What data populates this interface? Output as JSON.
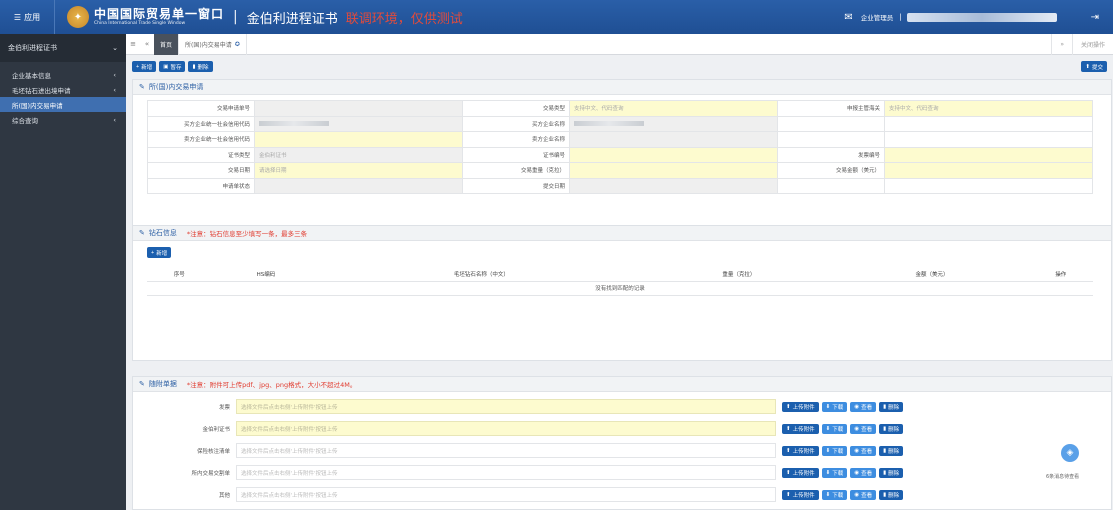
{
  "topbar": {
    "menu_label": "应用",
    "brand_cn": "中国国际贸易单一窗口",
    "brand_en": "China International Trade Single Window",
    "app_title": "金伯利进程证书",
    "env_note": "联调环境，仅供测试",
    "user_label": "企业管理员"
  },
  "sidebar": {
    "header": "金伯利进程证书",
    "items": [
      {
        "label": "企业基本信息",
        "arrow": "‹"
      },
      {
        "label": "毛坯钻石进出境申请",
        "arrow": "‹"
      },
      {
        "label": "所(国)内交易申请",
        "arrow": ""
      },
      {
        "label": "综合查询",
        "arrow": "‹"
      }
    ]
  },
  "tabs": {
    "home": "首页",
    "current": "所(国)内交易申请",
    "close_ops": "关闭操作"
  },
  "toolbar": {
    "add": "新增",
    "save": "暂存",
    "delete": "删除",
    "submit": "提交"
  },
  "trade_panel": {
    "title": "所(国)内交易申请",
    "rows": [
      [
        {
          "label": "交易申请单号",
          "value": "",
          "cls": "val"
        },
        {
          "label": "交易类型",
          "value": "支持中文、代码查询",
          "cls": "val y"
        },
        {
          "label": "申报主管海关",
          "value": "支持中文、代码查询",
          "cls": "val y"
        }
      ],
      [
        {
          "label": "买方企业统一社会信用代码",
          "value": "",
          "cls": "val",
          "blur": true
        },
        {
          "label": "买方企业名称",
          "value": "",
          "cls": "val",
          "blur": true
        },
        {
          "label": "",
          "value": "",
          "cls": "val w"
        }
      ],
      [
        {
          "label": "卖方企业统一社会信用代码",
          "value": "",
          "cls": "val y"
        },
        {
          "label": "卖方企业名称",
          "value": "",
          "cls": "val"
        },
        {
          "label": "",
          "value": "",
          "cls": "val w"
        }
      ],
      [
        {
          "label": "证书类型",
          "value": "金伯利证书",
          "cls": "val"
        },
        {
          "label": "证书编号",
          "value": "",
          "cls": "val y"
        },
        {
          "label": "发票编号",
          "value": "",
          "cls": "val y"
        }
      ],
      [
        {
          "label": "交易日期",
          "value": "请选择日期",
          "cls": "val y"
        },
        {
          "label": "交易重量（克拉）",
          "value": "",
          "cls": "val y"
        },
        {
          "label": "交易金额（美元）",
          "value": "",
          "cls": "val y"
        }
      ],
      [
        {
          "label": "申请单状态",
          "value": "",
          "cls": "val"
        },
        {
          "label": "提交日期",
          "value": "",
          "cls": "val"
        },
        {
          "label": "",
          "value": "",
          "cls": "val w"
        }
      ]
    ]
  },
  "diamond_panel": {
    "title": "钻石信息",
    "note": "*注意：钻石信息至少填写一条，最多三条",
    "add": "新增",
    "columns": [
      "序号",
      "HS编码",
      "毛坯钻石名称（中文）",
      "重量（克拉）",
      "金额（美元）",
      "操作"
    ],
    "empty": "没有找到匹配的记录"
  },
  "attach_panel": {
    "title": "随附单据",
    "note": "*注意：附件可上传pdf、jpg、png格式，大小不超过4M。",
    "placeholder": "选择文件后点击右侧'上传附件'按钮上传",
    "buttons": {
      "upload": "上传附件",
      "download": "下载",
      "view": "查看",
      "delete": "删除"
    },
    "rows": [
      {
        "label": "发票",
        "cls": "att-in"
      },
      {
        "label": "金伯利证书",
        "cls": "att-in"
      },
      {
        "label": "保险核注清单",
        "cls": "att-in w"
      },
      {
        "label": "所内交易交割单",
        "cls": "att-in w"
      },
      {
        "label": "其他",
        "cls": "att-in w"
      }
    ]
  },
  "float": {
    "label": "6条消息待查看"
  }
}
